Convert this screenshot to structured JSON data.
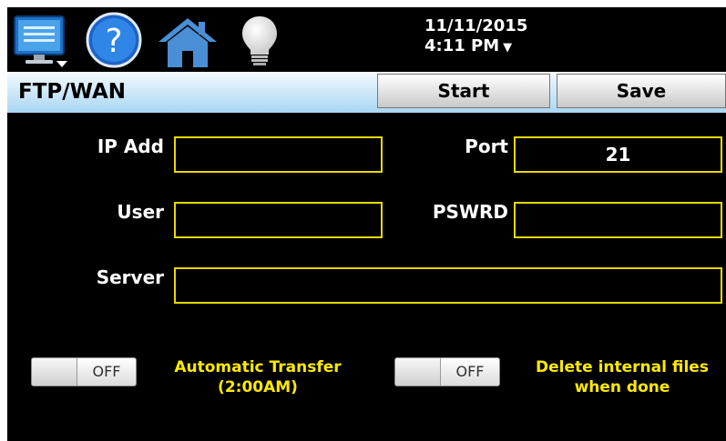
{
  "top_bar": {
    "date": "11/11/2015",
    "time": "4:11 PM",
    "time_menu_glyph": "▼",
    "icons": [
      "monitor-menu-icon",
      "help-icon",
      "home-icon",
      "lightbulb-icon"
    ],
    "help_glyph": "?"
  },
  "header": {
    "title": "FTP/WAN",
    "start_label": "Start",
    "save_label": "Save"
  },
  "form": {
    "ip_label": "IP Add",
    "ip_value": "",
    "port_label": "Port",
    "port_value": "21",
    "user_label": "User",
    "user_value": "",
    "password_label": "PSWRD",
    "password_value": "",
    "server_label": "Server",
    "server_value": ""
  },
  "options": {
    "auto_transfer_state": "OFF",
    "auto_transfer_label_1": "Automatic Transfer",
    "auto_transfer_label_2": "(2:00AM)",
    "delete_files_state": "OFF",
    "delete_files_label_1": "Delete internal files",
    "delete_files_label_2": "when done"
  },
  "colors": {
    "background": "#000000",
    "field_border": "#e6d900",
    "option_text": "#ffea00",
    "title_bar_top": "#f4faff",
    "title_bar_bottom": "#a8d6f2"
  }
}
